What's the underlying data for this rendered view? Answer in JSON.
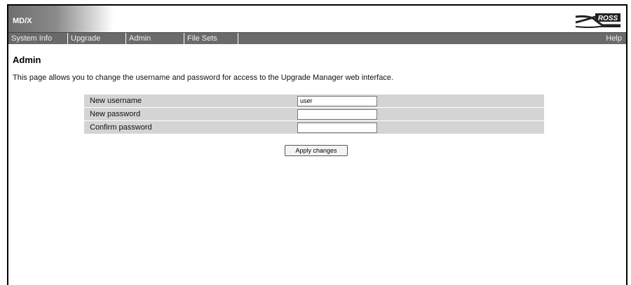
{
  "header": {
    "app_title": "MD/X",
    "brand_text": "ROSS"
  },
  "nav": {
    "items": [
      {
        "label": "System Info"
      },
      {
        "label": "Upgrade"
      },
      {
        "label": "Admin"
      },
      {
        "label": "File Sets"
      }
    ],
    "help": "Help"
  },
  "page": {
    "title": "Admin",
    "description": "This page allows you to change the username and password for access to the Upgrade Manager web interface."
  },
  "form": {
    "username_label": "New username",
    "username_value": "user",
    "password_label": "New password",
    "password_value": "",
    "confirm_label": "Confirm password",
    "confirm_value": "",
    "apply_label": "Apply changes"
  }
}
